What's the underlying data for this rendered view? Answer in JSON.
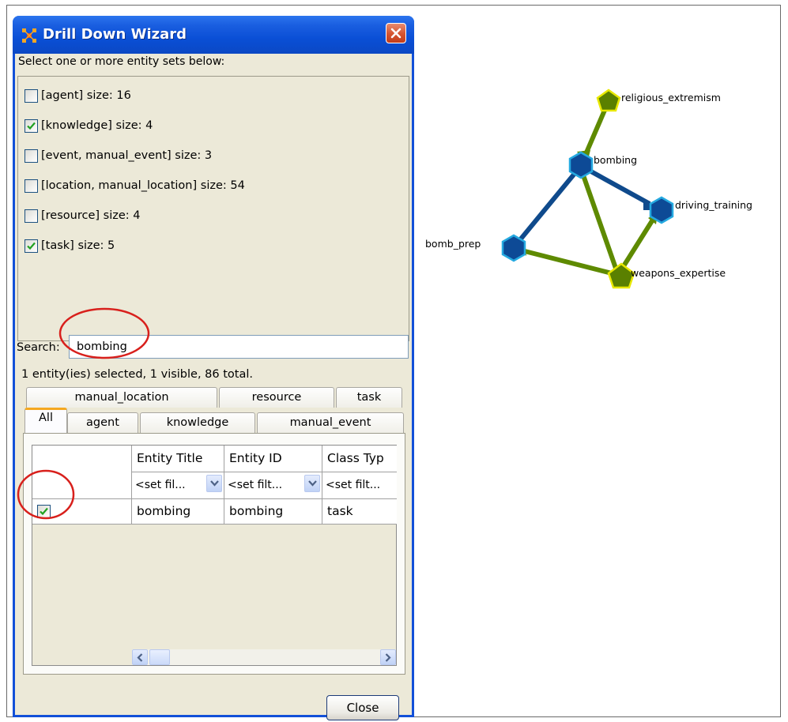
{
  "window": {
    "title": "Drill Down Wizard",
    "prompt": "Select one or more entity sets below:",
    "entity_sets": [
      {
        "label": "[agent] size: 16",
        "checked": false
      },
      {
        "label": "[knowledge] size: 4",
        "checked": true
      },
      {
        "label": "[event, manual_event] size: 3",
        "checked": false
      },
      {
        "label": "[location, manual_location] size: 54",
        "checked": false
      },
      {
        "label": "[resource] size: 4",
        "checked": false
      },
      {
        "label": "[task] size: 5",
        "checked": true
      }
    ],
    "search": {
      "label": "Search:",
      "value": "bombing"
    },
    "status": "1 entity(ies) selected, 1 visible, 86 total.",
    "tabs_back": [
      "manual_location",
      "resource",
      "task"
    ],
    "tabs_front": [
      "All",
      "agent",
      "knowledge",
      "manual_event"
    ],
    "active_tab": "All",
    "table": {
      "columns": [
        "Entity Title",
        "Entity ID",
        "Class Typ"
      ],
      "filters": [
        "<set fil...",
        "<set filt...",
        "<set filt..."
      ],
      "rows": [
        {
          "selected": true,
          "cells": [
            "bombing",
            "bombing",
            "task"
          ]
        }
      ]
    },
    "close_label": "Close"
  },
  "graph": {
    "nodes": [
      {
        "id": "religious_extremism",
        "label": "religious_extremism",
        "shape": "pentagon"
      },
      {
        "id": "bombing",
        "label": "bombing",
        "shape": "hexagon"
      },
      {
        "id": "driving_training",
        "label": "driving_training",
        "shape": "hexagon"
      },
      {
        "id": "bomb_prep",
        "label": "bomb_prep",
        "shape": "hexagon"
      },
      {
        "id": "weapons_expertise",
        "label": "weapons_expertise",
        "shape": "pentagon"
      }
    ],
    "edges": [
      {
        "from": "religious_extremism",
        "to": "bombing",
        "color": "green"
      },
      {
        "from": "bombing",
        "to": "driving_training",
        "color": "blue"
      },
      {
        "from": "bombing",
        "to": "bomb_prep",
        "color": "blue"
      },
      {
        "from": "weapons_expertise",
        "to": "bombing",
        "color": "green"
      },
      {
        "from": "weapons_expertise",
        "to": "bomb_prep",
        "color": "green"
      },
      {
        "from": "weapons_expertise",
        "to": "driving_training",
        "color": "green"
      }
    ],
    "colors": {
      "task_node": "#0d4a96",
      "task_stroke": "#25a9e0",
      "knowledge_node": "#5a8000",
      "knowledge_stroke": "#e8e800",
      "blue_edge": "#0f4a8c",
      "green_edge": "#5e8a00"
    }
  },
  "annotation_color": "#d8201c"
}
